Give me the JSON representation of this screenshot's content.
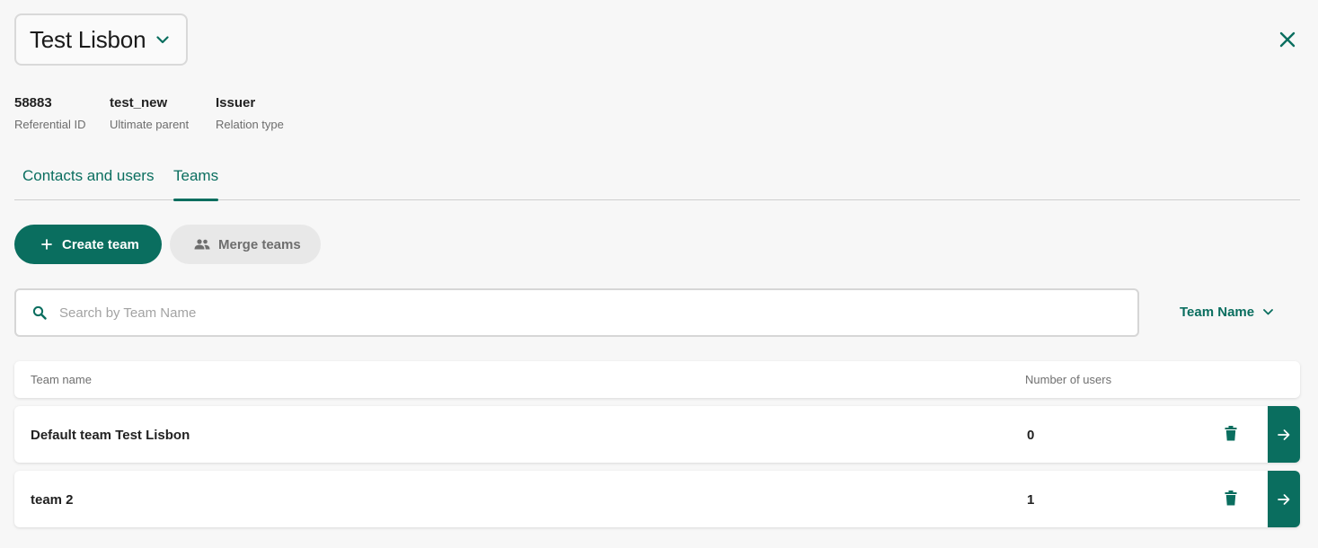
{
  "entity": {
    "name": "Test Lisbon",
    "dropdown_icon": "chevron-down-icon"
  },
  "close_icon": "close-icon",
  "meta": [
    {
      "value": "58883",
      "label": "Referential ID"
    },
    {
      "value": "test_new",
      "label": "Ultimate parent"
    },
    {
      "value": "Issuer",
      "label": "Relation type"
    }
  ],
  "tabs": [
    {
      "label": "Contacts and users",
      "active": false
    },
    {
      "label": "Teams",
      "active": true
    }
  ],
  "actions": {
    "create_label": "Create team",
    "create_icon": "plus-icon",
    "merge_label": "Merge teams",
    "merge_icon": "group-icon"
  },
  "search": {
    "placeholder": "Search by Team Name",
    "value": "",
    "icon": "search-icon"
  },
  "sort": {
    "label": "Team Name",
    "icon": "chevron-down-icon"
  },
  "table": {
    "columns": [
      "Team name",
      "Number of users"
    ],
    "rows": [
      {
        "name": "Default team Test Lisbon",
        "users": "0"
      },
      {
        "name": "team 2",
        "users": "1"
      }
    ]
  },
  "colors": {
    "accent": "#0a6e5f",
    "background": "#f7f7f7",
    "secondary_button": "#e8e8e8"
  }
}
